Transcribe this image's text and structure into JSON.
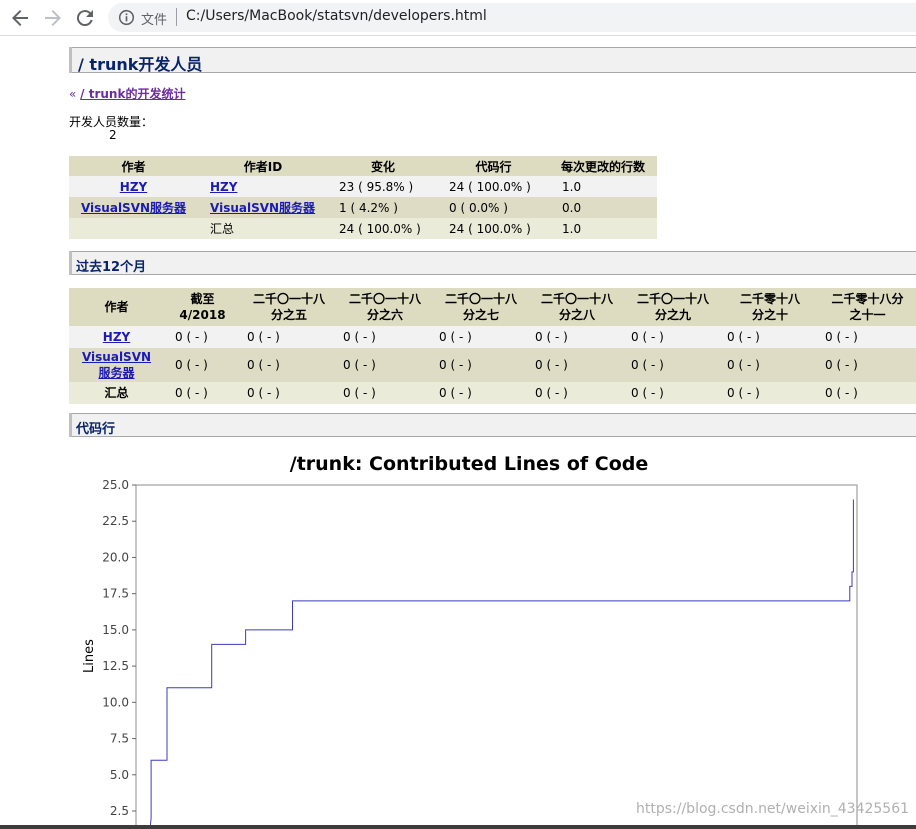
{
  "browser": {
    "scheme_label": "文件",
    "url": "C:/Users/MacBook/statsvn/developers.html"
  },
  "page": {
    "heading": "/ trunk开发人员",
    "back_prefix": "«",
    "back_link": "/ trunk的开发统计",
    "dev_count_label": "开发人员数量：",
    "dev_count_value": "2"
  },
  "dev_table": {
    "headers": [
      "作者",
      "作者ID",
      "变化",
      "代码行",
      "每次更改的行数"
    ],
    "rows": [
      {
        "author": "HZY",
        "author_id": "HZY",
        "changes": "23 ( 95.8% )",
        "lines": "24 ( 100.0% )",
        "per_change": "1.0"
      },
      {
        "author": "VisualSVN服务器",
        "author_id": "VisualSVN服务器",
        "changes": "1 ( 4.2% )",
        "lines": "0 ( 0.0% )",
        "per_change": "0.0"
      }
    ],
    "total": {
      "label": "汇总",
      "changes": "24 ( 100.0% )",
      "lines": "24 ( 100.0% )",
      "per_change": "1.0"
    }
  },
  "months_section": {
    "heading": "过去12个月",
    "headers": [
      {
        "l1": "作者",
        "l2": ""
      },
      {
        "l1": "截至",
        "l2": "4/2018"
      },
      {
        "l1": "二千〇一十八",
        "l2": "分之五"
      },
      {
        "l1": "二千〇一十八",
        "l2": "分之六"
      },
      {
        "l1": "二千〇一十八",
        "l2": "分之七"
      },
      {
        "l1": "二千〇一十八",
        "l2": "分之八"
      },
      {
        "l1": "二千〇一十八",
        "l2": "分之九"
      },
      {
        "l1": "二千零十八",
        "l2": "分之十"
      },
      {
        "l1": "二千零十八分",
        "l2": "之十一"
      }
    ],
    "rows": [
      {
        "author_l1": "HZY",
        "author_l2": "",
        "link": true,
        "cells": [
          "0 ( - )",
          "0 ( - )",
          "0 ( - )",
          "0 ( - )",
          "0 ( - )",
          "0 ( - )",
          "0 ( - )",
          "0 ( - )"
        ]
      },
      {
        "author_l1": "VisualSVN",
        "author_l2": "服务器",
        "link": true,
        "cells": [
          "0 ( - )",
          "0 ( - )",
          "0 ( - )",
          "0 ( - )",
          "0 ( - )",
          "0 ( - )",
          "0 ( - )",
          "0 ( - )"
        ]
      },
      {
        "author_l1": "汇总",
        "author_l2": "",
        "link": false,
        "cells": [
          "0 ( - )",
          "0 ( - )",
          "0 ( - )",
          "0 ( - )",
          "0 ( - )",
          "0 ( - )",
          "0 ( - )",
          "0 ( - )"
        ]
      }
    ]
  },
  "loc_section": {
    "heading": "代码行"
  },
  "watermark": "https://blog.csdn.net/weixin_43425561",
  "chart_data": {
    "type": "line",
    "title": "/trunk: Contributed Lines of Code",
    "ylabel": "Lines",
    "xlabel": "",
    "ylim": [
      1.5,
      25.0
    ],
    "xlim": [
      0,
      100
    ],
    "yticks": [
      "2.5",
      "5.0",
      "7.5",
      "10.0",
      "12.5",
      "15.0",
      "17.5",
      "20.0",
      "22.5",
      "25.0"
    ],
    "series_color": "#3b3bbf",
    "series": [
      {
        "x": [
          2,
          2.1,
          2.1,
          4.3,
          4.3,
          10.5,
          10.5,
          15.2,
          15.2,
          21.7,
          21.7,
          99.0,
          99.0,
          99.3,
          99.3,
          99.5,
          99.5
        ],
        "y": [
          1.5,
          2.0,
          6.0,
          6.0,
          11.0,
          11.0,
          14.0,
          14.0,
          15.0,
          15.0,
          17.0,
          17.0,
          18.0,
          18.0,
          19.0,
          19.0,
          24.0
        ]
      }
    ]
  }
}
